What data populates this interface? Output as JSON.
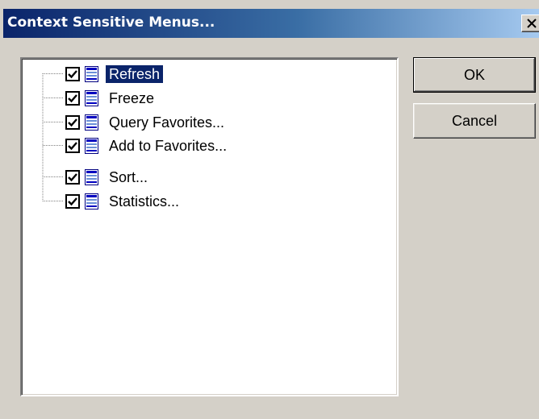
{
  "window": {
    "title": "Context Sensitive Menus..."
  },
  "tree": {
    "items": [
      {
        "label": "Refresh",
        "checked": true,
        "selected": true,
        "icon": "menu-list-icon"
      },
      {
        "label": "Freeze",
        "checked": true,
        "selected": false,
        "icon": "menu-list-icon"
      },
      {
        "label": "Query Favorites...",
        "checked": true,
        "selected": false,
        "icon": "menu-list-icon"
      },
      {
        "label": "Add to Favorites...",
        "checked": true,
        "selected": false,
        "icon": "menu-list-icon"
      },
      {
        "label": "Sort...",
        "checked": true,
        "selected": false,
        "icon": "menu-list-icon"
      },
      {
        "label": "Statistics...",
        "checked": true,
        "selected": false,
        "icon": "menu-list-icon"
      }
    ]
  },
  "buttons": {
    "ok_label": "OK",
    "cancel_label": "Cancel"
  },
  "colors": {
    "title_gradient_start": "#0a246a",
    "title_gradient_end": "#a6caf0",
    "selection": "#0a246a",
    "dialog_face": "#d4d0c8"
  }
}
